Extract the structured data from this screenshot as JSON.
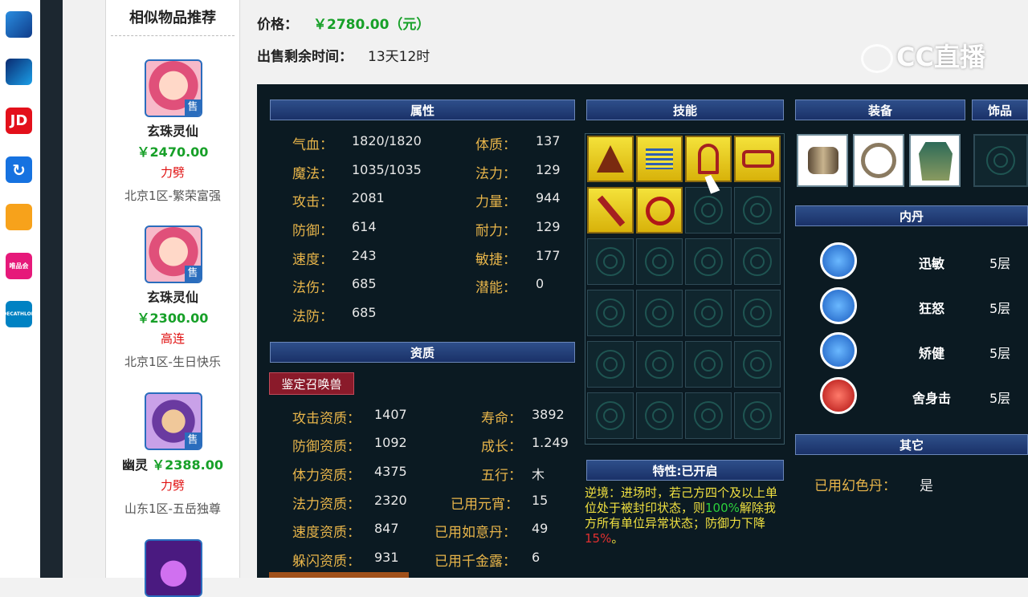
{
  "dock": {
    "icons": [
      {
        "name": "game-app-icon",
        "text": ""
      },
      {
        "name": "blue-app-icon",
        "text": ""
      },
      {
        "name": "jd-icon",
        "text": "JD"
      },
      {
        "name": "refresh-app-icon",
        "text": "↻"
      },
      {
        "name": "orange-app-icon",
        "text": ""
      },
      {
        "name": "vipshop-icon",
        "text": "唯品会"
      },
      {
        "name": "decathlon-icon",
        "text": "DECATHLON"
      }
    ]
  },
  "sidebar": {
    "title": "相似物品推荐",
    "items": [
      {
        "name": "玄珠灵仙",
        "price": "￥2470.00",
        "attr": "力劈",
        "server": "北京1区-繁荣富强",
        "badge": "售"
      },
      {
        "name": "玄珠灵仙",
        "price": "￥2300.00",
        "attr": "高连",
        "server": "北京1区-生日快乐",
        "badge": "售"
      },
      {
        "name": "幽灵",
        "price": "￥2388.00",
        "attr": "力劈",
        "server": "山东1区-五岳独尊",
        "badge": "售"
      }
    ]
  },
  "info": {
    "price_label": "价格：",
    "price_value": "￥2780.00（元）",
    "time_label": "出售剩余时间：",
    "time_value": "13天12时"
  },
  "watermark": "CC直播",
  "panel": {
    "attr_header": "属性",
    "skills_header": "技能",
    "equip_header": "装备",
    "ornament_header": "饰品",
    "neidan_header": "内丹",
    "other_header": "其它",
    "zizhi_header": "资质",
    "trait_header": "特性:已开启",
    "attributes": [
      {
        "label": "气血：",
        "value": "1820/1820"
      },
      {
        "label": "魔法：",
        "value": "1035/1035"
      },
      {
        "label": "攻击：",
        "value": "2081"
      },
      {
        "label": "防御：",
        "value": "614"
      },
      {
        "label": "速度：",
        "value": "243"
      },
      {
        "label": "法伤：",
        "value": "685"
      },
      {
        "label": "法防：",
        "value": "685"
      }
    ],
    "attributes_right": [
      {
        "label": "体质：",
        "value": "137"
      },
      {
        "label": "法力：",
        "value": "129"
      },
      {
        "label": "力量：",
        "value": "944"
      },
      {
        "label": "耐力：",
        "value": "129"
      },
      {
        "label": "敏捷：",
        "value": "177"
      },
      {
        "label": "潜能：",
        "value": "0"
      }
    ],
    "identify_button": "鉴定召唤兽",
    "zizhi": [
      {
        "label": "攻击资质：",
        "value": "1407"
      },
      {
        "label": "防御资质：",
        "value": "1092"
      },
      {
        "label": "体力资质：",
        "value": "4375"
      },
      {
        "label": "法力资质：",
        "value": "2320"
      },
      {
        "label": "速度资质：",
        "value": "847"
      },
      {
        "label": "躲闪资质：",
        "value": "931"
      }
    ],
    "zizhi_right": [
      {
        "label": "寿命：",
        "value": "3892"
      },
      {
        "label": "成长：",
        "value": "1.249"
      },
      {
        "label": "五行：",
        "value": "木"
      },
      {
        "label": "已用元宵：",
        "value": "15"
      },
      {
        "label": "已用如意丹：",
        "value": "49"
      },
      {
        "label": "已用千金露：",
        "value": "6"
      }
    ],
    "neidan": [
      {
        "name": "迅敏",
        "level": "5层",
        "color": "#1f7fe0"
      },
      {
        "name": "狂怒",
        "level": "5层",
        "color": "#1f7fe0"
      },
      {
        "name": "矫健",
        "level": "5层",
        "color": "#1f7fe0"
      },
      {
        "name": "舍身击",
        "level": "5层",
        "color": "#d01818"
      }
    ],
    "other_label": "已用幻色丹：",
    "other_value": "是",
    "trait_text_1": "逆境：进场时，若己方四个及以上单位处于被封印状态，则",
    "trait_pct_1": "100%",
    "trait_text_2": "解除我方所有单位异常状态；防御力下降",
    "trait_pct_2": "15%",
    "trait_text_3": "。"
  }
}
